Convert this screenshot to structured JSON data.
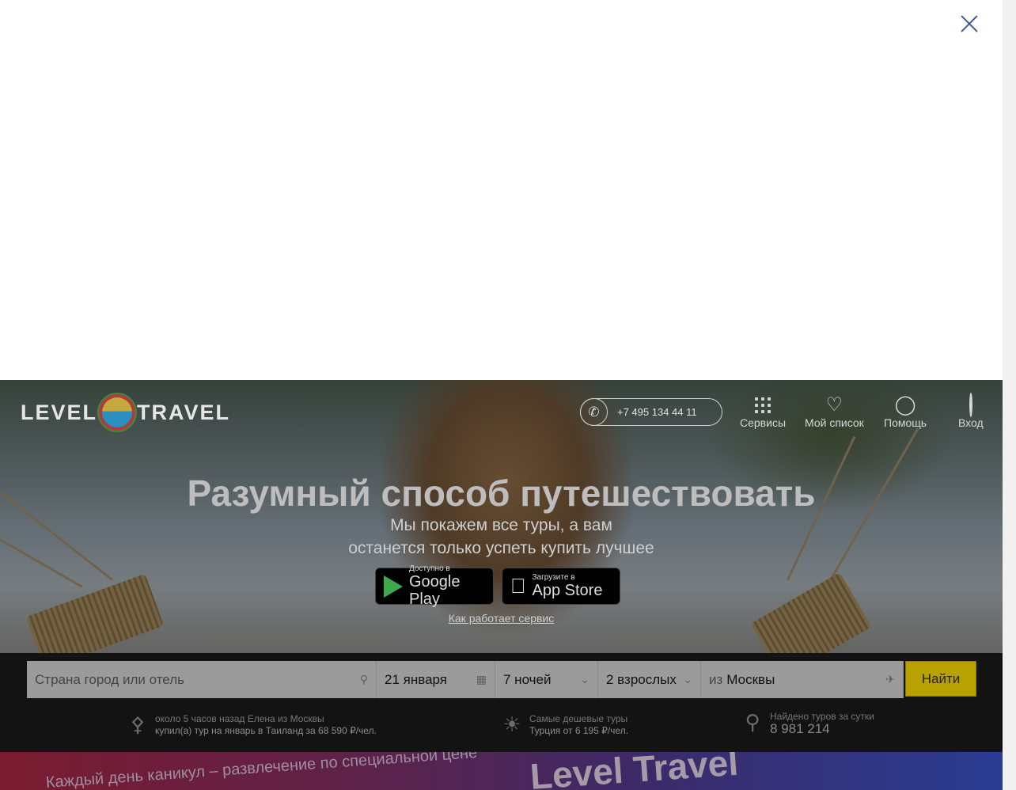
{
  "modal": {
    "close_icon": "close-icon"
  },
  "header": {
    "logo_left": "LEVEL",
    "logo_right": "TRAVEL",
    "phone": "+7 495 134 44 11",
    "nav": [
      {
        "label": "Сервисы",
        "icon": "grid-icon"
      },
      {
        "label": "Мой список",
        "icon": "heart-icon"
      },
      {
        "label": "Помощь",
        "icon": "lightbulb-icon"
      },
      {
        "label": "Вход",
        "icon": "user-icon"
      }
    ]
  },
  "hero": {
    "title": "Разумный способ путешествовать",
    "subtitle_line1": "Мы покажем все туры, а вам",
    "subtitle_line2": "останется только успеть купить лучшее",
    "google_play": {
      "small": "Доступно в",
      "big": "Google Play"
    },
    "app_store": {
      "small": "Загрузите в",
      "big": "App Store"
    },
    "how_it_works": "Как работает сервис"
  },
  "search": {
    "destination_placeholder": "Страна город или отель",
    "date": "21 января",
    "nights": "7 ночей",
    "travelers": "2 взрослых",
    "from_prefix": "из",
    "from_city": "Москвы",
    "submit": "Найти"
  },
  "stats": {
    "recent_line1": "около 5 часов назад Елена из Москвы",
    "recent_line2": "купил(а) тур на январь в Таиланд за 68 590 ₽/чел.",
    "cheapest_line1": "Самые дешевые туры",
    "cheapest_line2": "Турция от 6 195 ₽/чел.",
    "found_label": "Найдено туров за сутки",
    "found_count": "8 981 214"
  },
  "promo": {
    "text_left_a": "Каждый день каникул –",
    "text_left_b": "развлечение по специальной цене",
    "brand": "Level Travel"
  }
}
